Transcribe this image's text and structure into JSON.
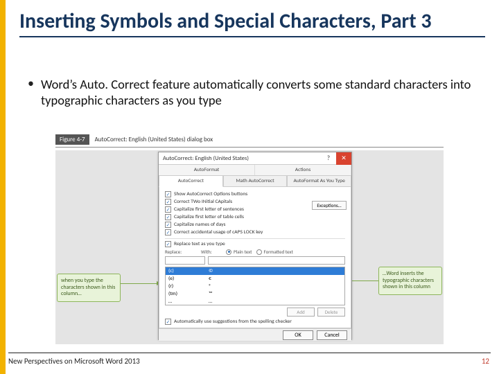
{
  "heading": "Inserting Symbols and Special Characters, Part 3",
  "bullet": "Word’s Auto. Correct feature automatically converts some standard characters into typographic characters as you type",
  "figure": {
    "num": "Figure 4-7",
    "caption": "AutoCorrect: English (United States) dialog box"
  },
  "callouts": {
    "left": "when you type the characters shown in this column…",
    "right": "…Word inserts the typographic characters shown in this column"
  },
  "dialog": {
    "title": "AutoCorrect: English (United States)",
    "tabs_top": [
      "AutoFormat",
      "Actions"
    ],
    "tabs_main": [
      "AutoCorrect",
      "Math AutoCorrect",
      "AutoFormat As You Type"
    ],
    "show_buttons": "Show AutoCorrect Options buttons",
    "checks": [
      "Correct TWo INitial CApitals",
      "Capitalize first letter of sentences",
      "Capitalize first letter of table cells",
      "Capitalize names of days",
      "Correct accidental usage of cAPS LOCK key"
    ],
    "exceptions": "Exceptions…",
    "replace_as_type": "Replace text as you type",
    "replace_label": "Replace:",
    "with_label": "With:",
    "radio_plain": "Plain text",
    "radio_formatted": "Formatted text",
    "list": [
      {
        "from": "(c)",
        "to": "©"
      },
      {
        "from": "(e)",
        "to": "€"
      },
      {
        "from": "(r)",
        "to": "®"
      },
      {
        "from": "(tm)",
        "to": "™"
      },
      {
        "from": "…",
        "to": "…"
      }
    ],
    "btn_add": "Add",
    "btn_delete": "Delete",
    "auto_suggest": "Automatically use suggestions from the spelling checker",
    "btn_ok": "OK",
    "btn_cancel": "Cancel"
  },
  "footer": {
    "left": "New Perspectives on Microsoft Word 2013",
    "right": "12"
  }
}
